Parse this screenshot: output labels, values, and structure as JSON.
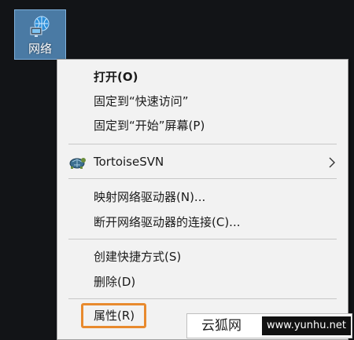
{
  "desktop": {
    "icon_label": "网络",
    "icon_name": "network-icon"
  },
  "context_menu": {
    "items": [
      {
        "label": "打开(O)",
        "bold": true
      },
      {
        "label": "固定到“快速访问”"
      },
      {
        "label": "固定到“开始”屏幕(P)"
      },
      {
        "label": "TortoiseSVN",
        "icon": "tortoise-svn-icon",
        "has_submenu": true
      },
      {
        "label": "映射网络驱动器(N)..."
      },
      {
        "label": "断开网络驱动器的连接(C)..."
      },
      {
        "label": "创建快捷方式(S)"
      },
      {
        "label": "删除(D)"
      },
      {
        "label": "属性(R)",
        "highlighted": true
      }
    ],
    "highlight_color": "#e88a2e"
  },
  "watermark": {
    "name": "云狐网",
    "url": "www.yunhu.net"
  },
  "colors": {
    "desktop_bg": "#121417",
    "menu_bg": "#f2f2f2",
    "selection_bg": "#4a7aa4"
  }
}
